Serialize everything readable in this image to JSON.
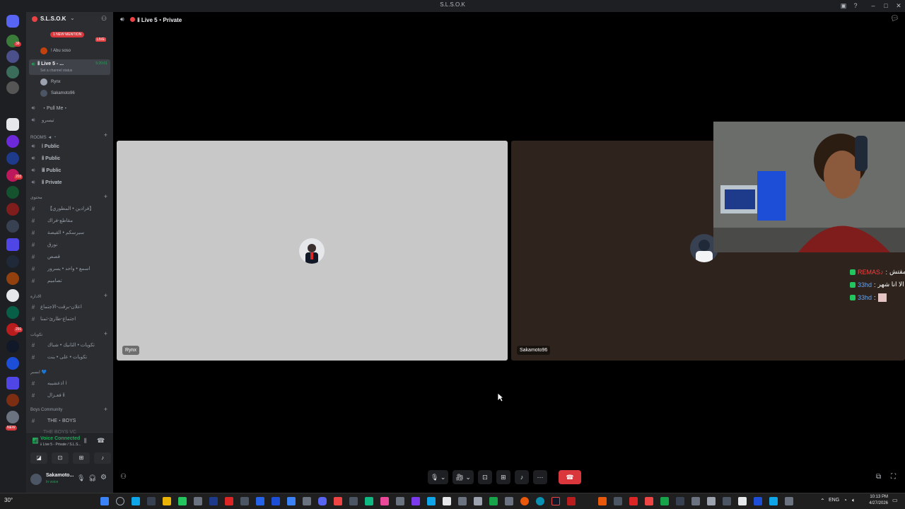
{
  "window": {
    "title": "S.L.S.O.K"
  },
  "server": {
    "name": "S.L.S.O.K"
  },
  "colors": {
    "accent": "#5865f2",
    "connected": "#23a55a",
    "danger": "#da373c",
    "live": "#ed4245",
    "mention": "#da373c",
    "chat_name_red": "#ef4444",
    "chat_name_blue": "#60a5fa"
  },
  "channel_list": {
    "mention_pill": "1 NEW MENTION",
    "live_badge": "LIVE",
    "top_user": "! Abu soso",
    "active_channel": {
      "name": "ⅱ Live 5 - ...",
      "time": "5:20:01",
      "status": "Set a channel status"
    },
    "voice_users": [
      "Rynx",
      "Sakamoto96"
    ],
    "pull_me": "・Pull Me・",
    "pull_sub": "تيسرو",
    "rooms_category": "ROOMS ◄ ・",
    "rooms": [
      {
        "label": "ⅰ Public"
      },
      {
        "label": "ⅱ Public"
      },
      {
        "label": "ⅲ Public"
      },
      {
        "label": "ⅱ Private"
      }
    ],
    "cat2": "محتوى",
    "text_channels_1": [
      "【فرادين • المطوري】",
      "مقاطع-فراك",
      "سيرسكم • القيصة",
      "نورق",
      "قصص",
      "اسمع • واحد • يسرور",
      "تصاميم"
    ],
    "cat3": "الادارة",
    "text_channels_2": [
      "اعلان-برقت-الاجتماع",
      "اجتماع-طارئ-ثمنا"
    ],
    "cat4": "تكويات",
    "text_channels_3": [
      "تكويات • الثانيك • شباك",
      "تكويات • على • بنت"
    ],
    "cat5": "ابسبر 💙",
    "text_channels_4": [
      "اذعشيبه ⅰ",
      "فعـزال ⅱ"
    ],
    "boys_category": "Boys Community",
    "boys_channel": "THE・BOYS",
    "boys_more": "THE BOYS VC"
  },
  "voice_panel": {
    "status": "Voice Connected",
    "channel": "ⅱ Live 5 - Private / S.L.S..."
  },
  "user_panel": {
    "username": "Sakamoto...",
    "substatus": "In voice"
  },
  "main_header": {
    "channel": "ⅱ Live 5・Private"
  },
  "tiles": [
    {
      "name": "Rynx",
      "bg": "#c8c8c8"
    },
    {
      "name": "Sakamoto96",
      "bg": "#2e231d"
    }
  ],
  "stream_chat": [
    {
      "name": "REMAS♪",
      "text": "نويم؟ مقتش",
      "color": "#ef4444"
    },
    {
      "name": "33hd",
      "text": "كلكم سنه الا انا شهر",
      "color": "#60a5fa"
    },
    {
      "name": "33hd",
      "text": "",
      "color": "#60a5fa"
    }
  ],
  "taskbar": {
    "weather": "30°",
    "lang": "ENG",
    "time": "10:13 PM",
    "date": "4/27/2026"
  },
  "icons": [
    "discord-icon",
    "search-icon",
    "mic-icon",
    "camera-icon",
    "screen-share-icon",
    "activities-icon",
    "soundboard-icon",
    "more-icon",
    "hang-up-icon",
    "headphones-icon",
    "gear-icon",
    "windows-icon"
  ]
}
